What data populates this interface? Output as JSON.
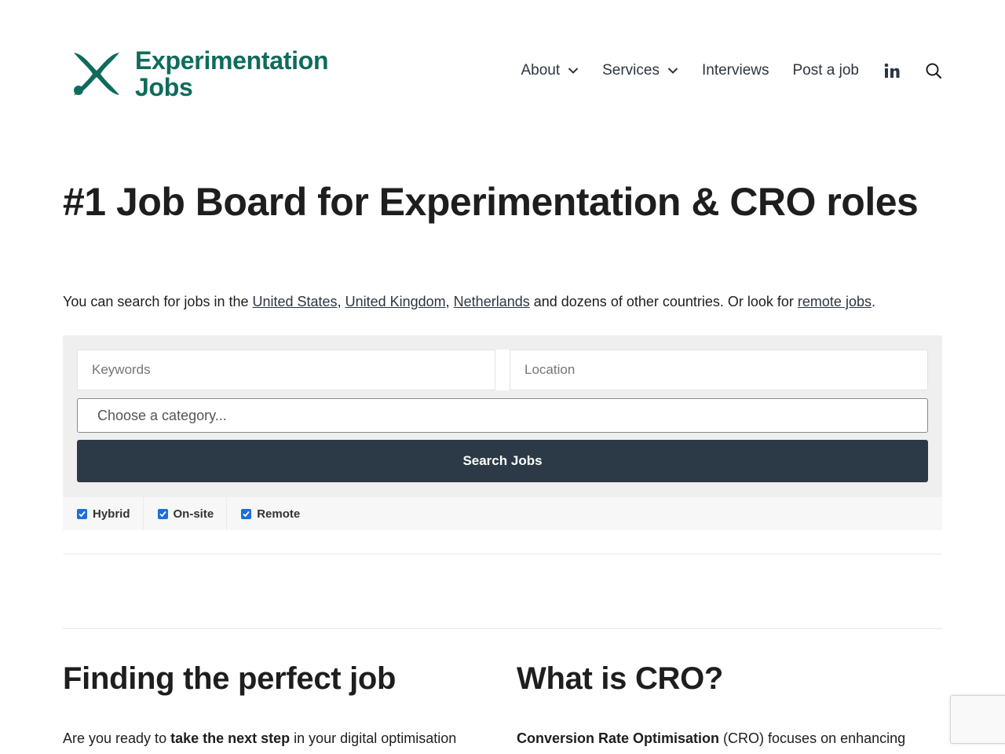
{
  "brand": {
    "name_line1": "Experimentation",
    "name_line2": "Jobs",
    "color": "#0f6b5c",
    "logo_icon": "x-mark-icon"
  },
  "nav": {
    "items": [
      {
        "label": "About",
        "dropdown": true
      },
      {
        "label": "Services",
        "dropdown": true
      },
      {
        "label": "Interviews",
        "dropdown": false
      },
      {
        "label": "Post a job",
        "dropdown": false
      }
    ],
    "icons": [
      "linkedin-icon",
      "search-icon"
    ]
  },
  "hero": {
    "title": "#1 Job Board for Experimentation & CRO roles"
  },
  "intro": {
    "prefix": "You can search for jobs in the ",
    "link_us": "United States",
    "sep1": ", ",
    "link_uk": "United Kingdom",
    "sep2": ", ",
    "link_nl": "Netherlands",
    "middle": " and dozens of other countries. Or look for ",
    "link_remote": "remote jobs",
    "suffix": "."
  },
  "search": {
    "keywords_placeholder": "Keywords",
    "location_placeholder": "Location",
    "category_placeholder": "Choose a category...",
    "button_label": "Search Jobs",
    "button_color": "#2c3a47"
  },
  "job_types": [
    {
      "label": "Hybrid",
      "checked": true
    },
    {
      "label": "On-site",
      "checked": true
    },
    {
      "label": "Remote",
      "checked": true
    }
  ],
  "sections": {
    "left": {
      "title": "Finding the perfect job",
      "text_prefix": "Are you ready to ",
      "text_bold": "take the next step",
      "text_suffix": " in your digital optimisation"
    },
    "right": {
      "title": "What is CRO?",
      "text_bold": "Conversion Rate Optimisation",
      "text_suffix": " (CRO) focuses on enhancing"
    }
  }
}
